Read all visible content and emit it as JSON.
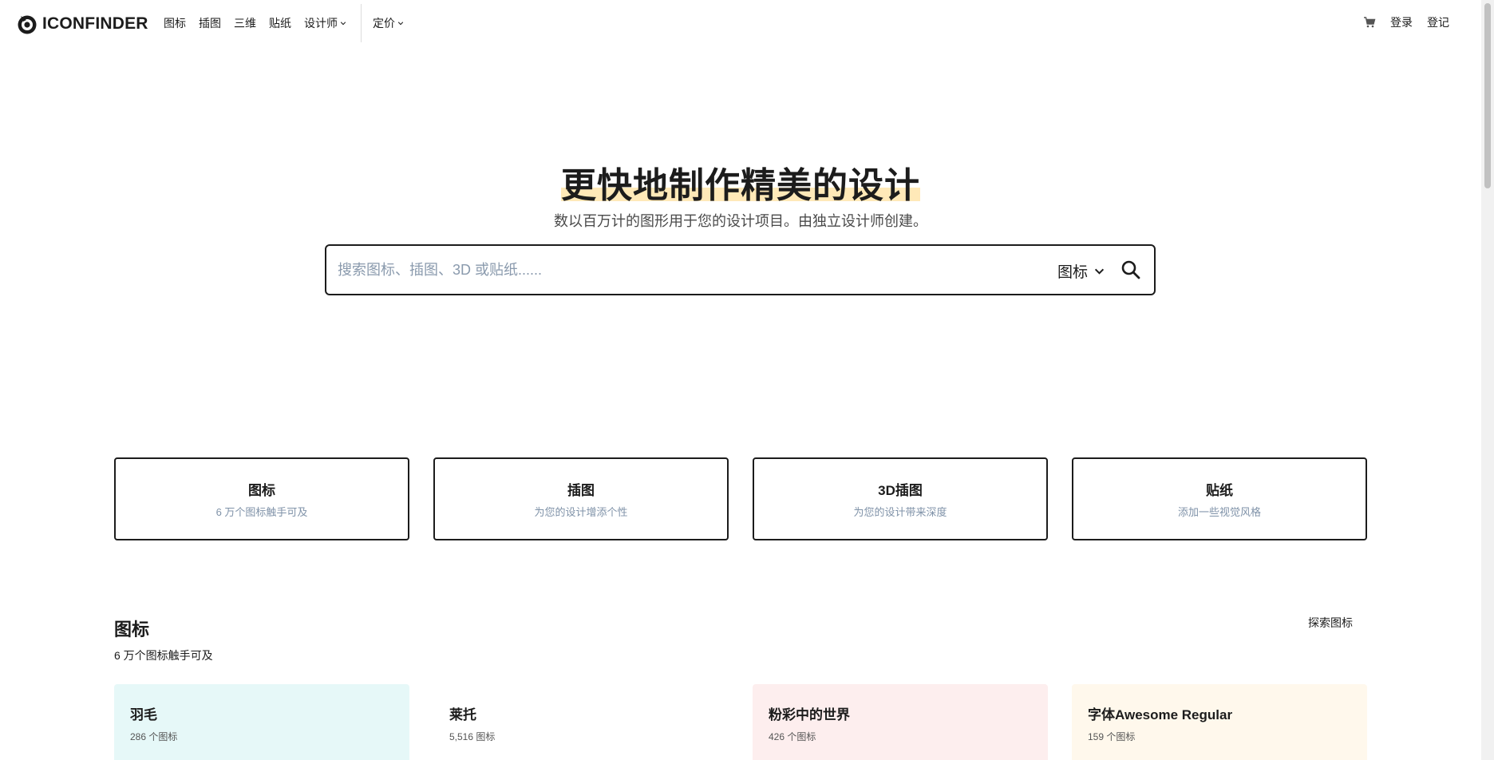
{
  "header": {
    "logo_text": "ICONFINDER",
    "nav": [
      {
        "label": "图标",
        "dropdown": false
      },
      {
        "label": "插图",
        "dropdown": false
      },
      {
        "label": "三维",
        "dropdown": false
      },
      {
        "label": "贴纸",
        "dropdown": false
      },
      {
        "label": "设计师",
        "dropdown": true
      }
    ],
    "pricing_label": "定价",
    "login_label": "登录",
    "register_label": "登记"
  },
  "hero": {
    "title": "更快地制作精美的设计",
    "subtitle": "数以百万计的图形用于您的设计项目。由独立设计师创建。",
    "search_placeholder": "搜索图标、插图、3D 或贴纸......",
    "search_value": "",
    "search_type": "图标"
  },
  "categories": [
    {
      "title": "图标",
      "subtitle": "6 万个图标触手可及"
    },
    {
      "title": "插图",
      "subtitle": "为您的设计增添个性"
    },
    {
      "title": "3D插图",
      "subtitle": "为您的设计带来深度"
    },
    {
      "title": "贴纸",
      "subtitle": "添加一些视觉风格"
    }
  ],
  "icon_section": {
    "title": "图标",
    "subtitle": "6 万个图标触手可及",
    "explore_label": "探索图标",
    "sets": [
      {
        "title": "羽毛",
        "count": "286 个图标",
        "bg": "#e6f8f8"
      },
      {
        "title": "莱托",
        "count": "5,516 图标",
        "bg": "#ffffff"
      },
      {
        "title": "粉彩中的世界",
        "count": "426 个图标",
        "bg": "#fdeeee"
      },
      {
        "title": "字体Awesome Regular",
        "count": "159 个图标",
        "bg": "#fff8ec"
      }
    ]
  },
  "colors": {
    "text": "#1c1c1c",
    "muted": "#7f92a8",
    "highlight": "#ffe9b8"
  }
}
